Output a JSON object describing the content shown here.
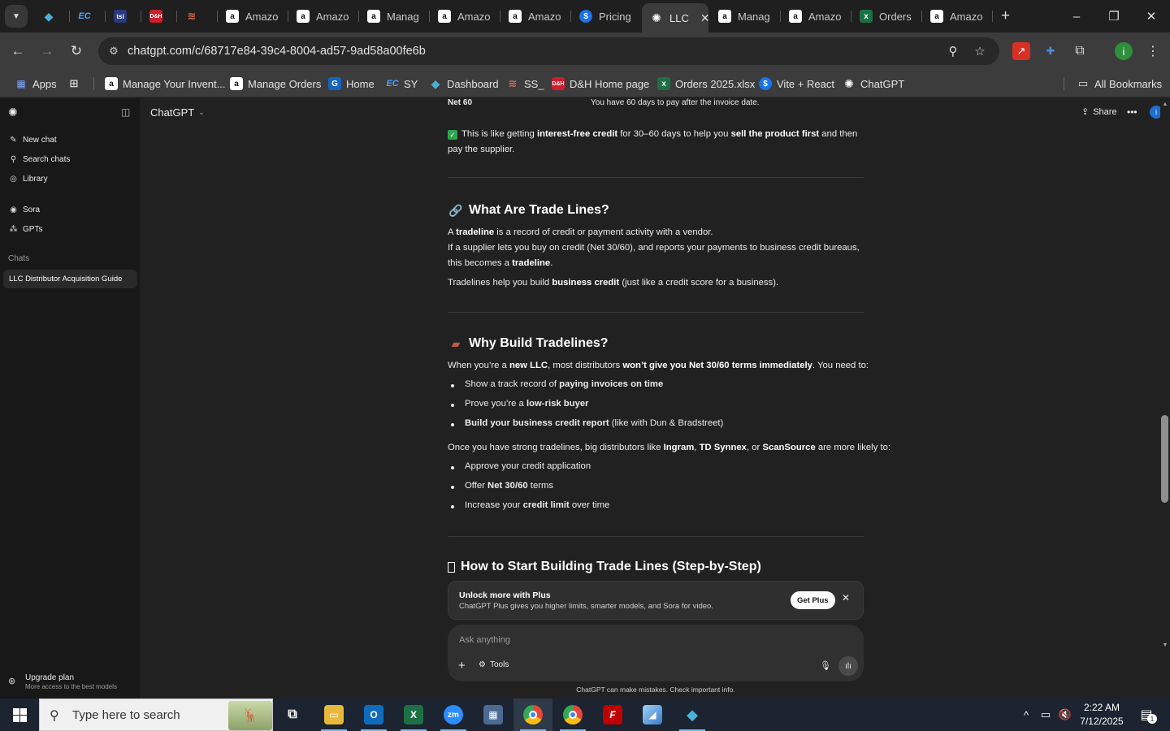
{
  "browser": {
    "tab_list_icon": "chevron-down-icon",
    "tabs": [
      {
        "label": "",
        "icon": "diamond-icon",
        "color": "#4ab0d8"
      },
      {
        "label": "",
        "icon": "ec-logo-icon",
        "color": "#1a73c9"
      },
      {
        "label": "",
        "icon": "tsi-logo-icon",
        "color": "#2b3a80"
      },
      {
        "label": "",
        "icon": "d-and-h-icon",
        "color": "#cc1f2b"
      },
      {
        "label": "",
        "icon": "stack-icon",
        "color": "#c44a3a"
      },
      {
        "label": "Amazo",
        "icon": "amazon-icon",
        "color": "#ffffff"
      },
      {
        "label": "Amazo",
        "icon": "amazon-icon",
        "color": "#ffffff"
      },
      {
        "label": "Manag",
        "icon": "amazon-icon",
        "color": "#ffffff"
      },
      {
        "label": "Amazo",
        "icon": "amazon-icon",
        "color": "#ffffff"
      },
      {
        "label": "Amazo",
        "icon": "amazon-icon",
        "color": "#ffffff"
      },
      {
        "label": "Pricing",
        "icon": "dollar-icon",
        "color": "#1a73e8"
      },
      {
        "label": "LLC",
        "icon": "chatgpt-icon",
        "color": "#ffffff",
        "active": true
      },
      {
        "label": "Manag",
        "icon": "amazon-icon",
        "color": "#ffffff"
      },
      {
        "label": "Amazo",
        "icon": "amazon-icon",
        "color": "#ffffff"
      },
      {
        "label": "Orders",
        "icon": "excel-icon",
        "color": "#1d7044"
      },
      {
        "label": "Amazo",
        "icon": "amazon-icon",
        "color": "#ffffff"
      }
    ],
    "new_tab_label": "+",
    "window_buttons": {
      "minimize": "–",
      "maximize": "❐",
      "close": "✕"
    },
    "url": "chatgpt.com/c/68717e84-39c4-8004-ad57-9ad58a00fe6b",
    "bookmarks": [
      {
        "label": "Apps",
        "icon": "apps-grid-icon"
      },
      {
        "label": "",
        "icon": "tab-groups-icon"
      },
      {
        "label": "Manage Your Invent...",
        "icon": "amazon-icon"
      },
      {
        "label": "Manage Orders",
        "icon": "amazon-icon"
      },
      {
        "label": "Home",
        "icon": "home-logo-icon"
      },
      {
        "label": "SY",
        "icon": "ec-logo-icon"
      },
      {
        "label": "Dashboard",
        "icon": "diamond-icon"
      },
      {
        "label": "SS_",
        "icon": "stack-icon"
      },
      {
        "label": "D&H Home page",
        "icon": "d-and-h-icon"
      },
      {
        "label": "Orders 2025.xlsx",
        "icon": "excel-icon"
      },
      {
        "label": "Vite + React",
        "icon": "dollar-icon"
      },
      {
        "label": "ChatGPT",
        "icon": "chatgpt-icon"
      }
    ],
    "all_bookmarks_label": "All Bookmarks",
    "profile_initial": "i"
  },
  "sidebar": {
    "new_chat": "New chat",
    "search_chats": "Search chats",
    "library": "Library",
    "sora": "Sora",
    "gpts": "GPTs",
    "chats_heading": "Chats",
    "active_chat": "LLC Distributor Acquisition Guide",
    "upgrade_title": "Upgrade plan",
    "upgrade_subtitle": "More access to the best models"
  },
  "header": {
    "model": "ChatGPT",
    "share": "Share",
    "profile_initial": "i"
  },
  "conversation": {
    "net60_term": "Net 60",
    "net60_desc": "You have 60 days to pay after the invoice date.",
    "credit_note_pre": "This is like getting ",
    "credit_note_b1": "interest-free credit",
    "credit_note_mid": " for 30–60 days to help you ",
    "credit_note_b2": "sell the product first",
    "credit_note_post": " and then pay the supplier.",
    "section1_title": "What Are Trade Lines?",
    "s1_p1_pre": "A ",
    "s1_p1_b": "tradeline",
    "s1_p1_post": " is a record of credit or payment activity with a vendor.",
    "s1_p2_pre": "If a supplier lets you buy on credit (Net 30/60), and reports your payments to business credit bureaus, this becomes a ",
    "s1_p2_b": "tradeline",
    "s1_p2_post": ".",
    "s1_p3_pre": "Tradelines help you build ",
    "s1_p3_b": "business credit",
    "s1_p3_post": " (just like a credit score for a business).",
    "section2_title": "Why Build Tradelines?",
    "s2_intro_pre": "When you’re a ",
    "s2_intro_b1": "new LLC",
    "s2_intro_mid": ", most distributors ",
    "s2_intro_b2": "won’t give you Net 30/60 terms immediately",
    "s2_intro_post": ". You need to:",
    "s2_b1_pre": "Show a track record of ",
    "s2_b1_b": "paying invoices on time",
    "s2_b2_pre": "Prove you’re a ",
    "s2_b2_b": "low-risk buyer",
    "s2_b3_b": "Build your business credit report",
    "s2_b3_post": " (like with Dun & Bradstreet)",
    "s2_outro_pre": "Once you have strong tradelines, big distributors like ",
    "s2_outro_b1": "Ingram",
    "s2_outro_s1": ", ",
    "s2_outro_b2": "TD Synnex",
    "s2_outro_s2": ", or ",
    "s2_outro_b3": "ScanSource",
    "s2_outro_post": " are more likely to:",
    "s2_c1": "Approve your credit application",
    "s2_c2_pre": "Offer ",
    "s2_c2_b": "Net 30/60",
    "s2_c2_post": " terms",
    "s2_c3_pre": "Increase your ",
    "s2_c3_b": "credit limit",
    "s2_c3_post": " over time",
    "section3_title": "How to Start Building Trade Lines (Step-by-Step)"
  },
  "banner": {
    "title": "Unlock more with Plus",
    "subtitle": "ChatGPT Plus gives you higher limits, smarter models, and Sora for video.",
    "cta": "Get Plus"
  },
  "composer": {
    "placeholder": "Ask anything",
    "tools": "Tools",
    "disclaimer": "ChatGPT can make mistakes. Check important info."
  },
  "taskbar": {
    "search_placeholder": "Type here to search",
    "apps": [
      {
        "name": "task-view-icon"
      },
      {
        "name": "file-explorer-icon",
        "color": "#e8b83a"
      },
      {
        "name": "outlook-icon",
        "color": "#0f6cbd"
      },
      {
        "name": "excel-icon",
        "color": "#1d7044"
      },
      {
        "name": "zoom-icon",
        "color": "#2d8cff"
      },
      {
        "name": "calculator-icon",
        "color": "#4c6a92"
      },
      {
        "name": "chrome-icon",
        "color": "#e8453c"
      },
      {
        "name": "chrome-icon",
        "color": "#e8453c"
      },
      {
        "name": "filezilla-icon",
        "color": "#bf0000"
      },
      {
        "name": "app-icon",
        "color": "#5aa9e6"
      },
      {
        "name": "diamond-app-icon",
        "color": "#4ab0d8"
      }
    ],
    "time": "2:22 AM",
    "date": "7/12/2025",
    "notification_count": "1"
  }
}
